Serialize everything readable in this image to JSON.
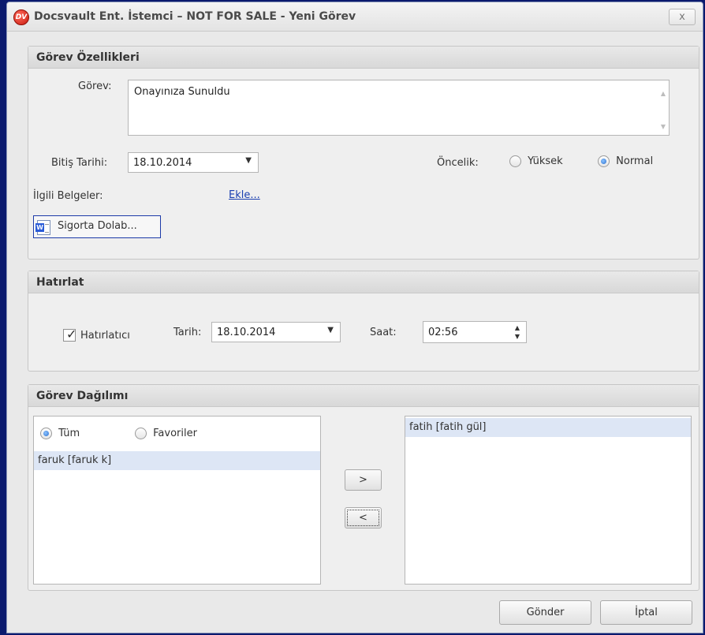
{
  "window": {
    "app_logo_text": "DV",
    "title": "Docsvault Ent. İstemci – NOT FOR SALE - Yeni Görev",
    "close_label": "x"
  },
  "task_properties": {
    "header": "Görev Özellikleri",
    "task_label": "Görev:",
    "task_value": "Onayınıza Sunuldu",
    "due_date_label": "Bitiş Tarihi:",
    "due_date_value": "18.10.2014",
    "priority_label": "Öncelik:",
    "priority_options": [
      {
        "label": "Yüksek",
        "selected": false
      },
      {
        "label": "Normal",
        "selected": true
      }
    ],
    "related_docs_label": "İlgili Belgeler:",
    "add_link": "Ekle...",
    "attached_document": {
      "name": "Sigorta Dolab...",
      "icon": "word-document-icon"
    }
  },
  "reminder": {
    "header": "Hatırlat",
    "checkbox_label": "Hatırlatıcı",
    "checked": true,
    "date_label": "Tarih:",
    "date_value": "18.10.2014",
    "time_label": "Saat:",
    "time_value": "02:56"
  },
  "distribution": {
    "header": "Görev Dağılımı",
    "filter_options": [
      {
        "label": "Tüm",
        "selected": true
      },
      {
        "label": "Favoriler",
        "selected": false
      }
    ],
    "available_users": [
      "faruk [faruk k]"
    ],
    "assigned_users": [
      "fatih [fatih gül]"
    ],
    "add_button": ">",
    "remove_button": "<"
  },
  "footer": {
    "send_button": "Gönder",
    "cancel_button": "İptal"
  },
  "colors": {
    "desktop": "#0b1a6e",
    "selection": "#dde6f5",
    "link": "#1a3fb0",
    "chip_border": "#1c3aa8"
  }
}
